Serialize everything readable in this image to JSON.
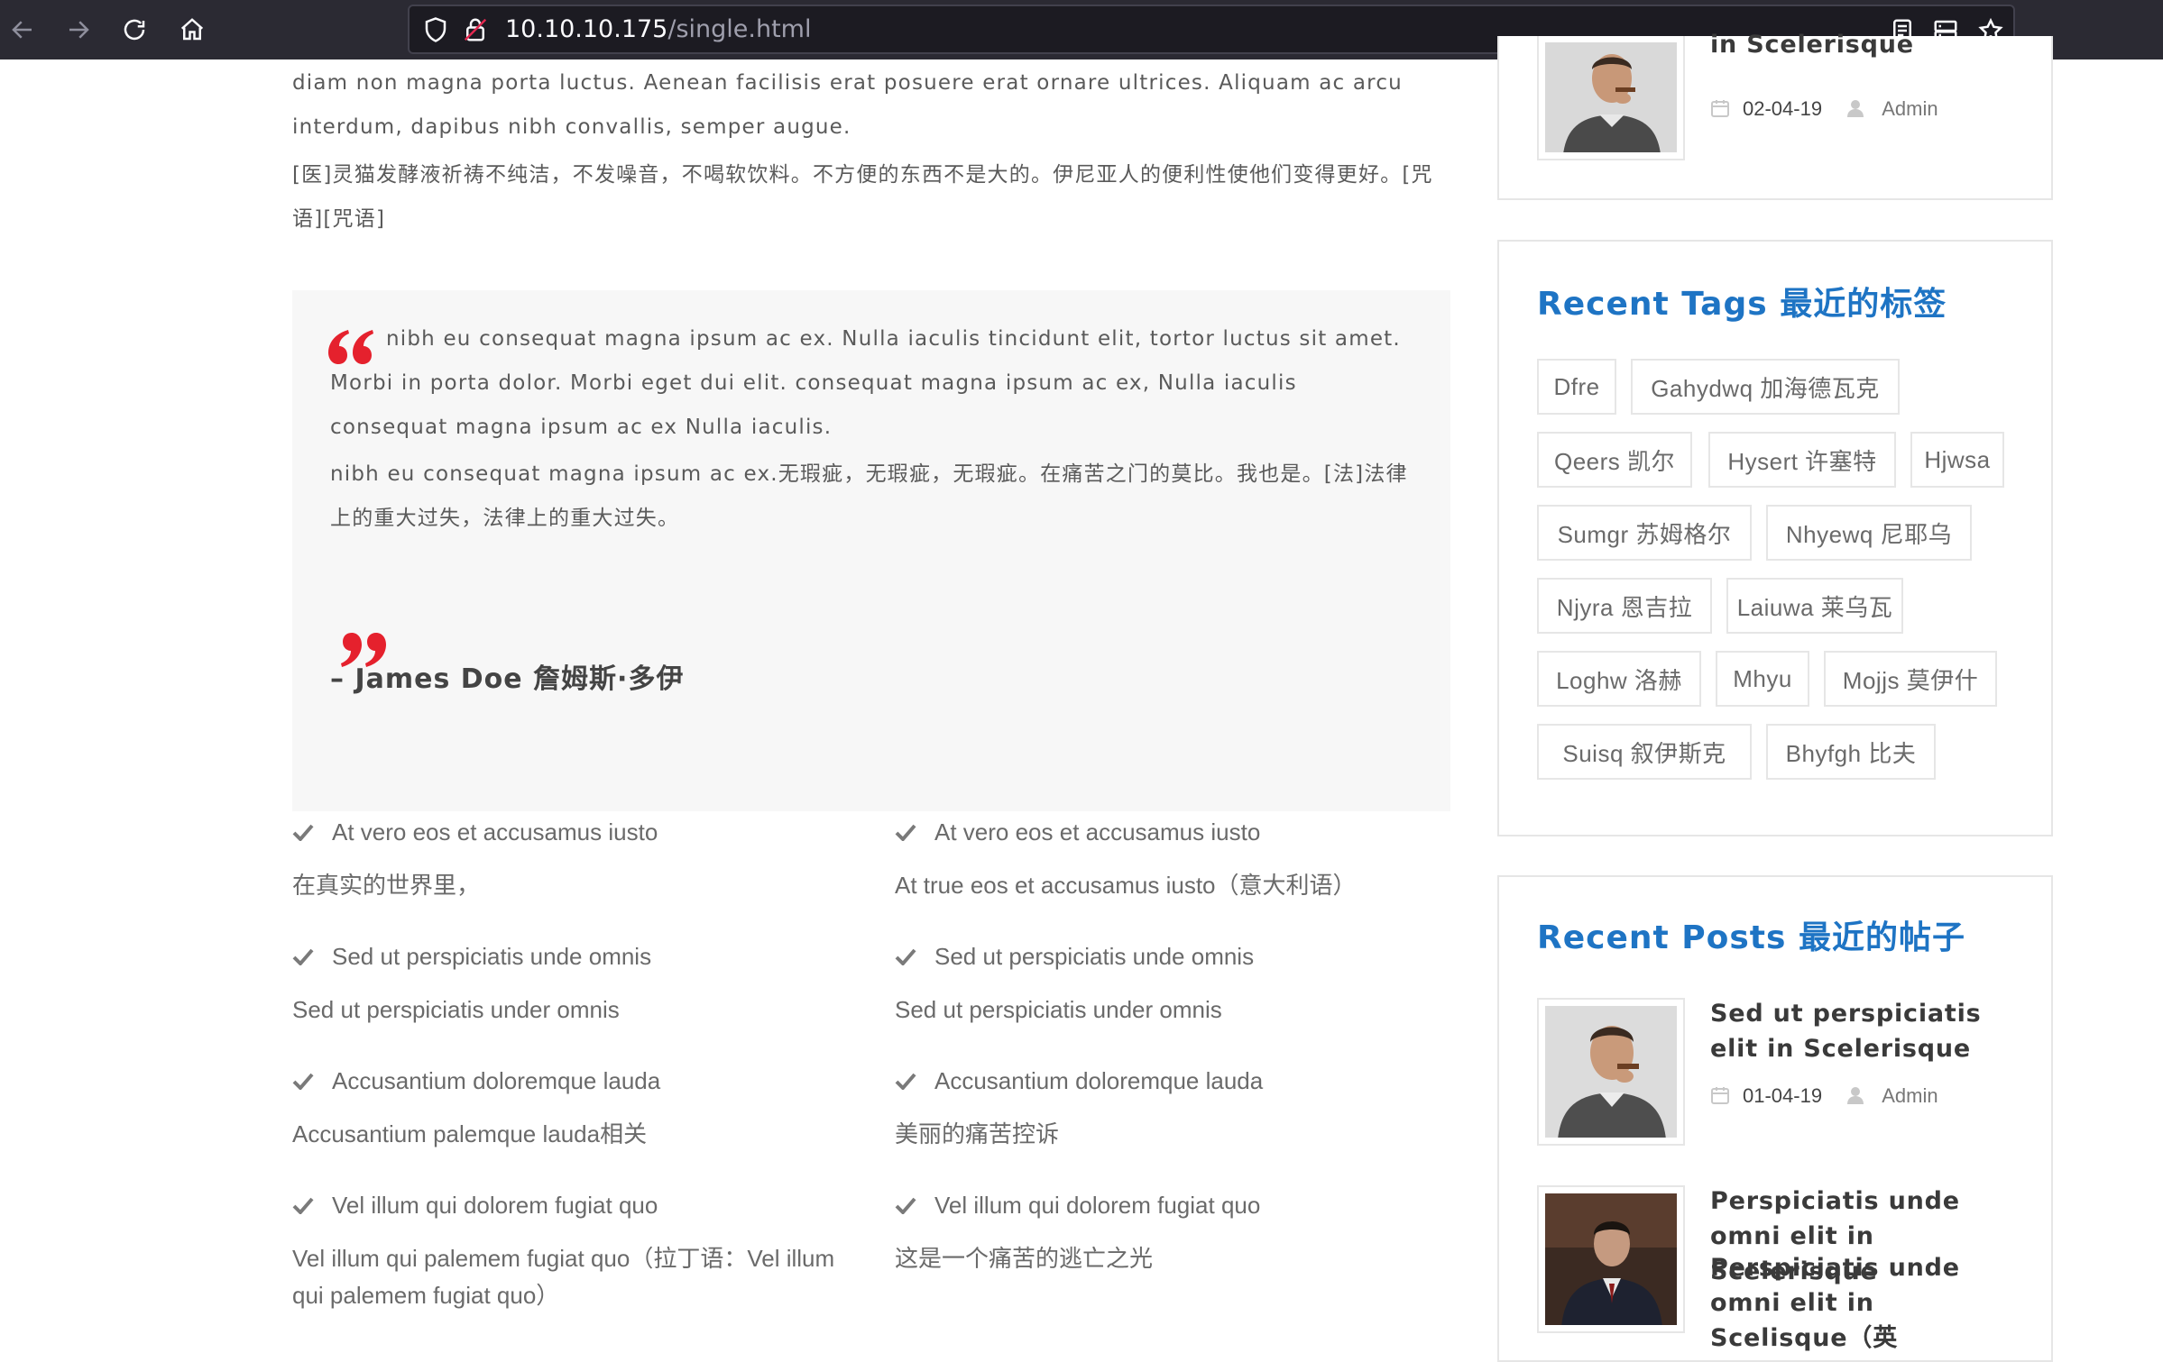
{
  "browser": {
    "url_host": "10.10.10.175",
    "url_path": "/single.html"
  },
  "article": {
    "paragraph_en": "diam non magna porta luctus. Aenean facilisis erat posuere erat ornare ultrices. Aliquam ac arcu interdum, dapibus nibh convallis, semper augue.",
    "paragraph_zh": "[医]灵猫发酵液祈祷不纯洁，不发噪音，不喝软饮料。不方便的东西不是大的。伊尼亚人的便利性使他们变得更好。[咒语][咒语]",
    "quote_en": "nibh eu consequat magna ipsum ac ex. Nulla iaculis tincidunt elit, tortor luctus sit amet. Morbi in porta dolor. Morbi eget dui elit. consequat magna ipsum ac ex, Nulla iaculis consequat magna ipsum ac ex Nulla iaculis.",
    "quote_zh": "nibh eu consequat magna ipsum ac ex.无瑕疵，无瑕疵，无瑕疵。在痛苦之门的莫比。我也是。[法]法律上的重大过失，法律上的重大过失。",
    "quote_author": "– James Doe  詹姆斯·多伊",
    "features_left": [
      {
        "title": "At vero eos et accusamus iusto",
        "desc": "在真实的世界里，"
      },
      {
        "title": "Sed ut perspiciatis unde omnis",
        "desc": "Sed ut perspiciatis under omnis"
      },
      {
        "title": "Accusantium doloremque lauda",
        "desc": "Accusantium palemque lauda相关"
      },
      {
        "title": "Vel illum qui dolorem fugiat quo",
        "desc": "Vel illum qui palemem fugiat quo（拉丁语：Vel illum qui palemem fugiat quo）"
      }
    ],
    "features_right": [
      {
        "title": "At vero eos et accusamus iusto",
        "desc": "At true eos et accusamus iusto（意大利语）"
      },
      {
        "title": "Sed ut perspiciatis unde omnis",
        "desc": "Sed ut perspiciatis under omnis"
      },
      {
        "title": "Accusantium doloremque lauda",
        "desc": "美丽的痛苦控诉"
      },
      {
        "title": "Vel illum qui dolorem fugiat quo",
        "desc": "这是一个痛苦的逃亡之光"
      }
    ]
  },
  "sidebar": {
    "top_post": {
      "title_fragment": "in Scelerisque",
      "date": "02-04-19",
      "author": "Admin"
    },
    "tags_title": "Recent Tags 最近的标签",
    "tags": [
      "Dfre",
      "Gahydwq  加海德瓦克",
      "Qeers  凯尔",
      "Hysert  许塞特",
      "Hjwsa",
      "Sumgr  苏姆格尔",
      "Nhyewq  尼耶乌",
      "Njyra  恩吉拉",
      "Laiuwa  莱乌瓦",
      "Loghw  洛赫",
      "Mhyu",
      "Mojjs  莫伊什",
      "Suisq  叙伊斯克",
      "Bhyfgh  比夫"
    ],
    "posts_title": "Recent Posts 最近的帖子",
    "posts": [
      {
        "title": "Sed ut perspiciatis elit in Scelerisque",
        "date": "01-04-19",
        "author": "Admin"
      },
      {
        "title": "Perspiciatis unde omni elit in Scelerisque",
        "subtitle": "Perspiciatis unde omni elit in Scelisque（英"
      }
    ]
  },
  "colors": {
    "accent_blue": "#1e74c4",
    "quote_red": "#e5212d",
    "browser_dark": "#2b2a33"
  }
}
